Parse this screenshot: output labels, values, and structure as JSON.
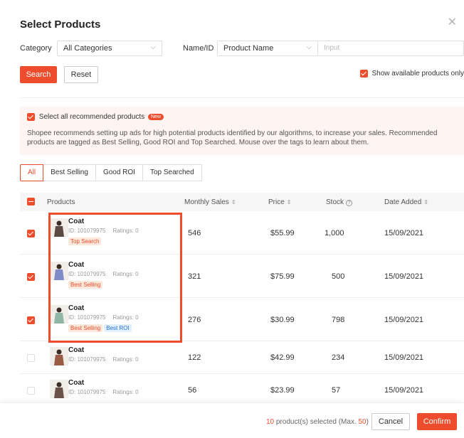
{
  "modal": {
    "title": "Select Products"
  },
  "filters": {
    "category_label": "Category",
    "category_value": "All Categories",
    "name_label": "Name/ID",
    "name_type_value": "Product Name",
    "input_placeholder": "Input"
  },
  "actions": {
    "search_label": "Search",
    "reset_label": "Reset",
    "show_available_label": "Show available products only"
  },
  "recommendation": {
    "select_all_label": "Select all recommended products",
    "new_badge": "New",
    "description": "Shopee recommends setting up ads for high potential products identified by our algorithms, to increase your sales. Recommended products are tagged as Best Selling, Good ROI and Top Searched. Mouse over the tags to learn about them."
  },
  "tabs": [
    {
      "label": "All",
      "active": true
    },
    {
      "label": "Best Selling",
      "active": false
    },
    {
      "label": "Good ROI",
      "active": false
    },
    {
      "label": "Top Searched",
      "active": false
    }
  ],
  "table": {
    "headers": {
      "products": "Products",
      "monthly_sales": "Monthly Sales",
      "price": "Price",
      "stock": "Stock",
      "date_added": "Date Added"
    },
    "rows": [
      {
        "checked": true,
        "name": "Coat",
        "id": "ID: 101079975",
        "ratings": "Ratings: 0",
        "tags": [
          {
            "text": "Top Search",
            "color": "orange"
          }
        ],
        "sales": "546",
        "price": "$55.99",
        "stock": "1,000",
        "date": "15/09/2021",
        "thumb_color": "#5a4a42"
      },
      {
        "checked": true,
        "name": "Coat",
        "id": "ID: 101079975",
        "ratings": "Ratings: 0",
        "tags": [
          {
            "text": "Best Selling",
            "color": "orange"
          }
        ],
        "sales": "321",
        "price": "$75.99",
        "stock": "500",
        "date": "15/09/2021",
        "thumb_color": "#7d8cc7"
      },
      {
        "checked": true,
        "name": "Coat",
        "id": "ID: 101079975",
        "ratings": "Ratings: 0",
        "tags": [
          {
            "text": "Best Selling",
            "color": "orange"
          },
          {
            "text": "Best ROI",
            "color": "blue"
          }
        ],
        "sales": "276",
        "price": "$30.99",
        "stock": "798",
        "date": "15/09/2021",
        "thumb_color": "#8fb6a6"
      },
      {
        "checked": false,
        "name": "Coat",
        "id": "ID: 101079975",
        "ratings": "Ratings: 0",
        "tags": [],
        "sales": "122",
        "price": "$42.99",
        "stock": "234",
        "date": "15/09/2021",
        "thumb_color": "#9a5b45"
      },
      {
        "checked": false,
        "name": "Coat",
        "id": "ID: 101079975",
        "ratings": "Ratings: 0",
        "tags": [],
        "sales": "56",
        "price": "$23.99",
        "stock": "57",
        "date": "15/09/2021",
        "thumb_color": "#6a5148"
      }
    ]
  },
  "footer": {
    "selected_count": "10",
    "selected_text": " product(s) selected (Max. ",
    "max_count": "50",
    "close_paren": ")",
    "cancel_label": "Cancel",
    "confirm_label": "Confirm"
  },
  "colors": {
    "accent": "#ee4d2d",
    "tag_blue": "#2673dd"
  }
}
